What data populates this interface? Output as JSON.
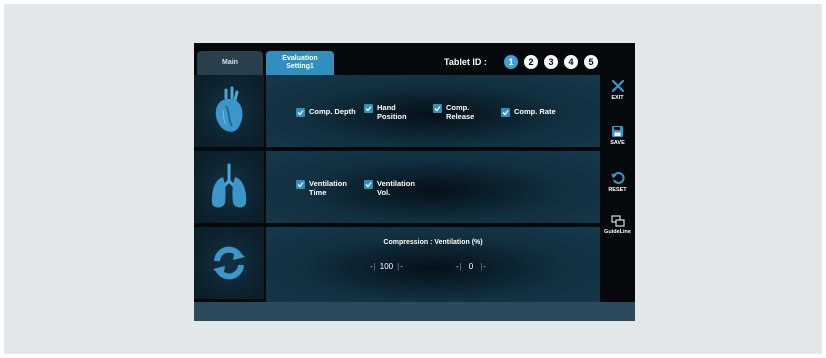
{
  "tabs": [
    {
      "label": "Main",
      "active": false
    },
    {
      "label": "Evaluation\nSetting1",
      "active": true
    }
  ],
  "tablet_id": {
    "label": "Tablet ID :",
    "ids": [
      "1",
      "2",
      "3",
      "4",
      "5"
    ],
    "selected": "1"
  },
  "rows": {
    "compression": {
      "icon": "heart-icon",
      "options": [
        {
          "label": "Comp. Depth",
          "checked": true
        },
        {
          "label": "Hand\nPosition",
          "checked": true
        },
        {
          "label": "Comp.\nRelease",
          "checked": true
        },
        {
          "label": "Comp. Rate",
          "checked": true
        }
      ]
    },
    "ventilation": {
      "icon": "lungs-icon",
      "options": [
        {
          "label": "Ventilation\nTime",
          "checked": true
        },
        {
          "label": "Ventilation\nVol.",
          "checked": true
        }
      ]
    },
    "ratio": {
      "icon": "cycle-icon",
      "title": "Compression : Ventilation (%)",
      "compression_value": "100",
      "ventilation_value": "0"
    }
  },
  "side_buttons": {
    "exit": "EXIT",
    "save": "SAVE",
    "reset": "RESET",
    "guideline": "GuideLine"
  },
  "colors": {
    "accent": "#2f8fbe",
    "background": "#03080b",
    "bottom_bar": "#2b4a5b"
  }
}
